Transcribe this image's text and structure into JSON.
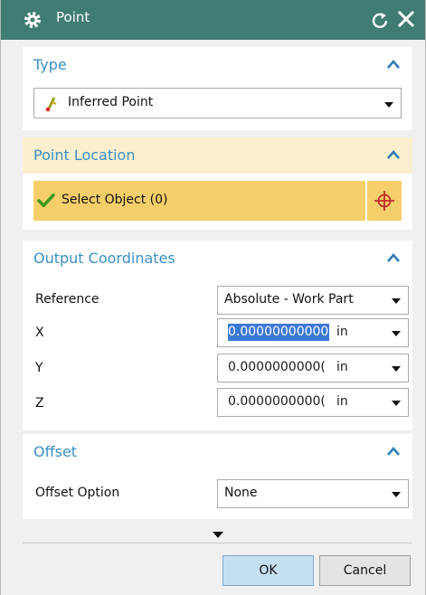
{
  "dialog": {
    "title": "Point"
  },
  "type": {
    "header": "Type",
    "value": "Inferred Point"
  },
  "point_location": {
    "header": "Point Location",
    "select_label": "Select Object (0)"
  },
  "output_coords": {
    "header": "Output Coordinates",
    "reference_label": "Reference",
    "reference_value": "Absolute - Work Part",
    "x_label": "X",
    "x_value": "0.00000000000",
    "x_unit": "in",
    "y_label": "Y",
    "y_value": "0.0000000000(",
    "y_unit": "in",
    "z_label": "Z",
    "z_value": "0.0000000000(",
    "z_unit": "in"
  },
  "offset": {
    "header": "Offset",
    "option_label": "Offset Option",
    "option_value": "None"
  },
  "buttons": {
    "ok": "OK",
    "cancel": "Cancel"
  },
  "colors": {
    "titlebar": "#3f7c72",
    "accent_text": "#3a8fc4",
    "highlight_row": "#f7cf6a",
    "highlight_header": "#fbefd0"
  },
  "icons": [
    "gear-icon",
    "reset-icon",
    "close-icon",
    "inferred-point-icon",
    "checkmark-icon",
    "point-dialog-icon",
    "chevron-up-icon",
    "dropdown-arrow-icon"
  ]
}
